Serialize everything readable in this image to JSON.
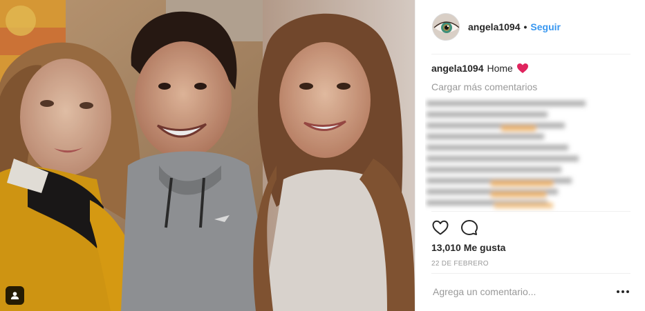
{
  "post": {
    "author": {
      "username": "angela1094",
      "follow_label": "Seguir",
      "separator": "•"
    },
    "caption": {
      "text": "Home",
      "emoji_icon": "red-heart-icon"
    },
    "load_more_label": "Cargar más comentarios",
    "likes_label": "13,010 Me gusta",
    "date_label": "22 DE FEBRERO",
    "comment_placeholder": "Agrega un comentario...",
    "icons": {
      "like": "heart-outline-icon",
      "comment": "speech-bubble-icon",
      "more": "more-options-icon",
      "tag": "user-tag-icon"
    }
  },
  "colors": {
    "link_blue": "#3897f0",
    "text_dark": "#262626",
    "text_muted": "#999999",
    "divider": "#efefef",
    "heart_red": "#e0245e"
  }
}
